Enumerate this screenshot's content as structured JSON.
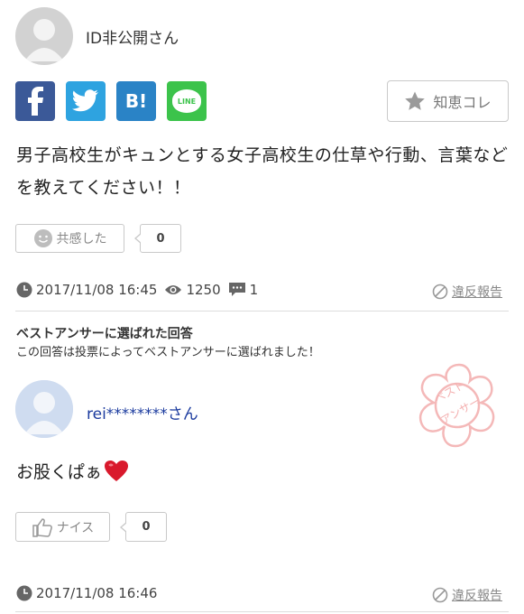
{
  "question": {
    "user": "ID非公開さん",
    "share": {
      "twitter_glyph": "🐦",
      "hatena": "B!",
      "line": "LINE"
    },
    "chie_label": "知恵コレ",
    "text": "男子高校生がキュンとする女子高校生の仕草や行動、言葉などを教えてください！！",
    "kyokan_label": "共感した",
    "kyokan_count": "0",
    "datetime": "2017/11/08 16:45",
    "views": "1250",
    "answers": "1",
    "report": "違反報告"
  },
  "best_answer": {
    "title": "ベストアンサーに選ばれた回答",
    "subtitle": "この回答は投票によってベストアンサーに選ばれました！",
    "stamp_text": "ベストアンサー",
    "user": "rei********さん",
    "text": "お股くぱぁ",
    "emoji": "❤️",
    "nice_label": "ナイス",
    "nice_count": "0",
    "datetime": "2017/11/08 16:46",
    "report": "違反報告"
  },
  "colors": {
    "facebook": "#3b5998",
    "twitter": "#2ea3e0",
    "hatena": "#2a83c6",
    "line": "#3cc34b",
    "answer_link": "#1a3a9e"
  },
  "icons": [
    "default-avatar-icon",
    "facebook-icon",
    "twitter-icon",
    "hatena-icon",
    "line-icon",
    "star-icon",
    "smile-icon",
    "clock-icon",
    "eye-icon",
    "comment-icon",
    "prohibit-icon",
    "thumbs-up-icon",
    "best-answer-stamp-icon"
  ]
}
